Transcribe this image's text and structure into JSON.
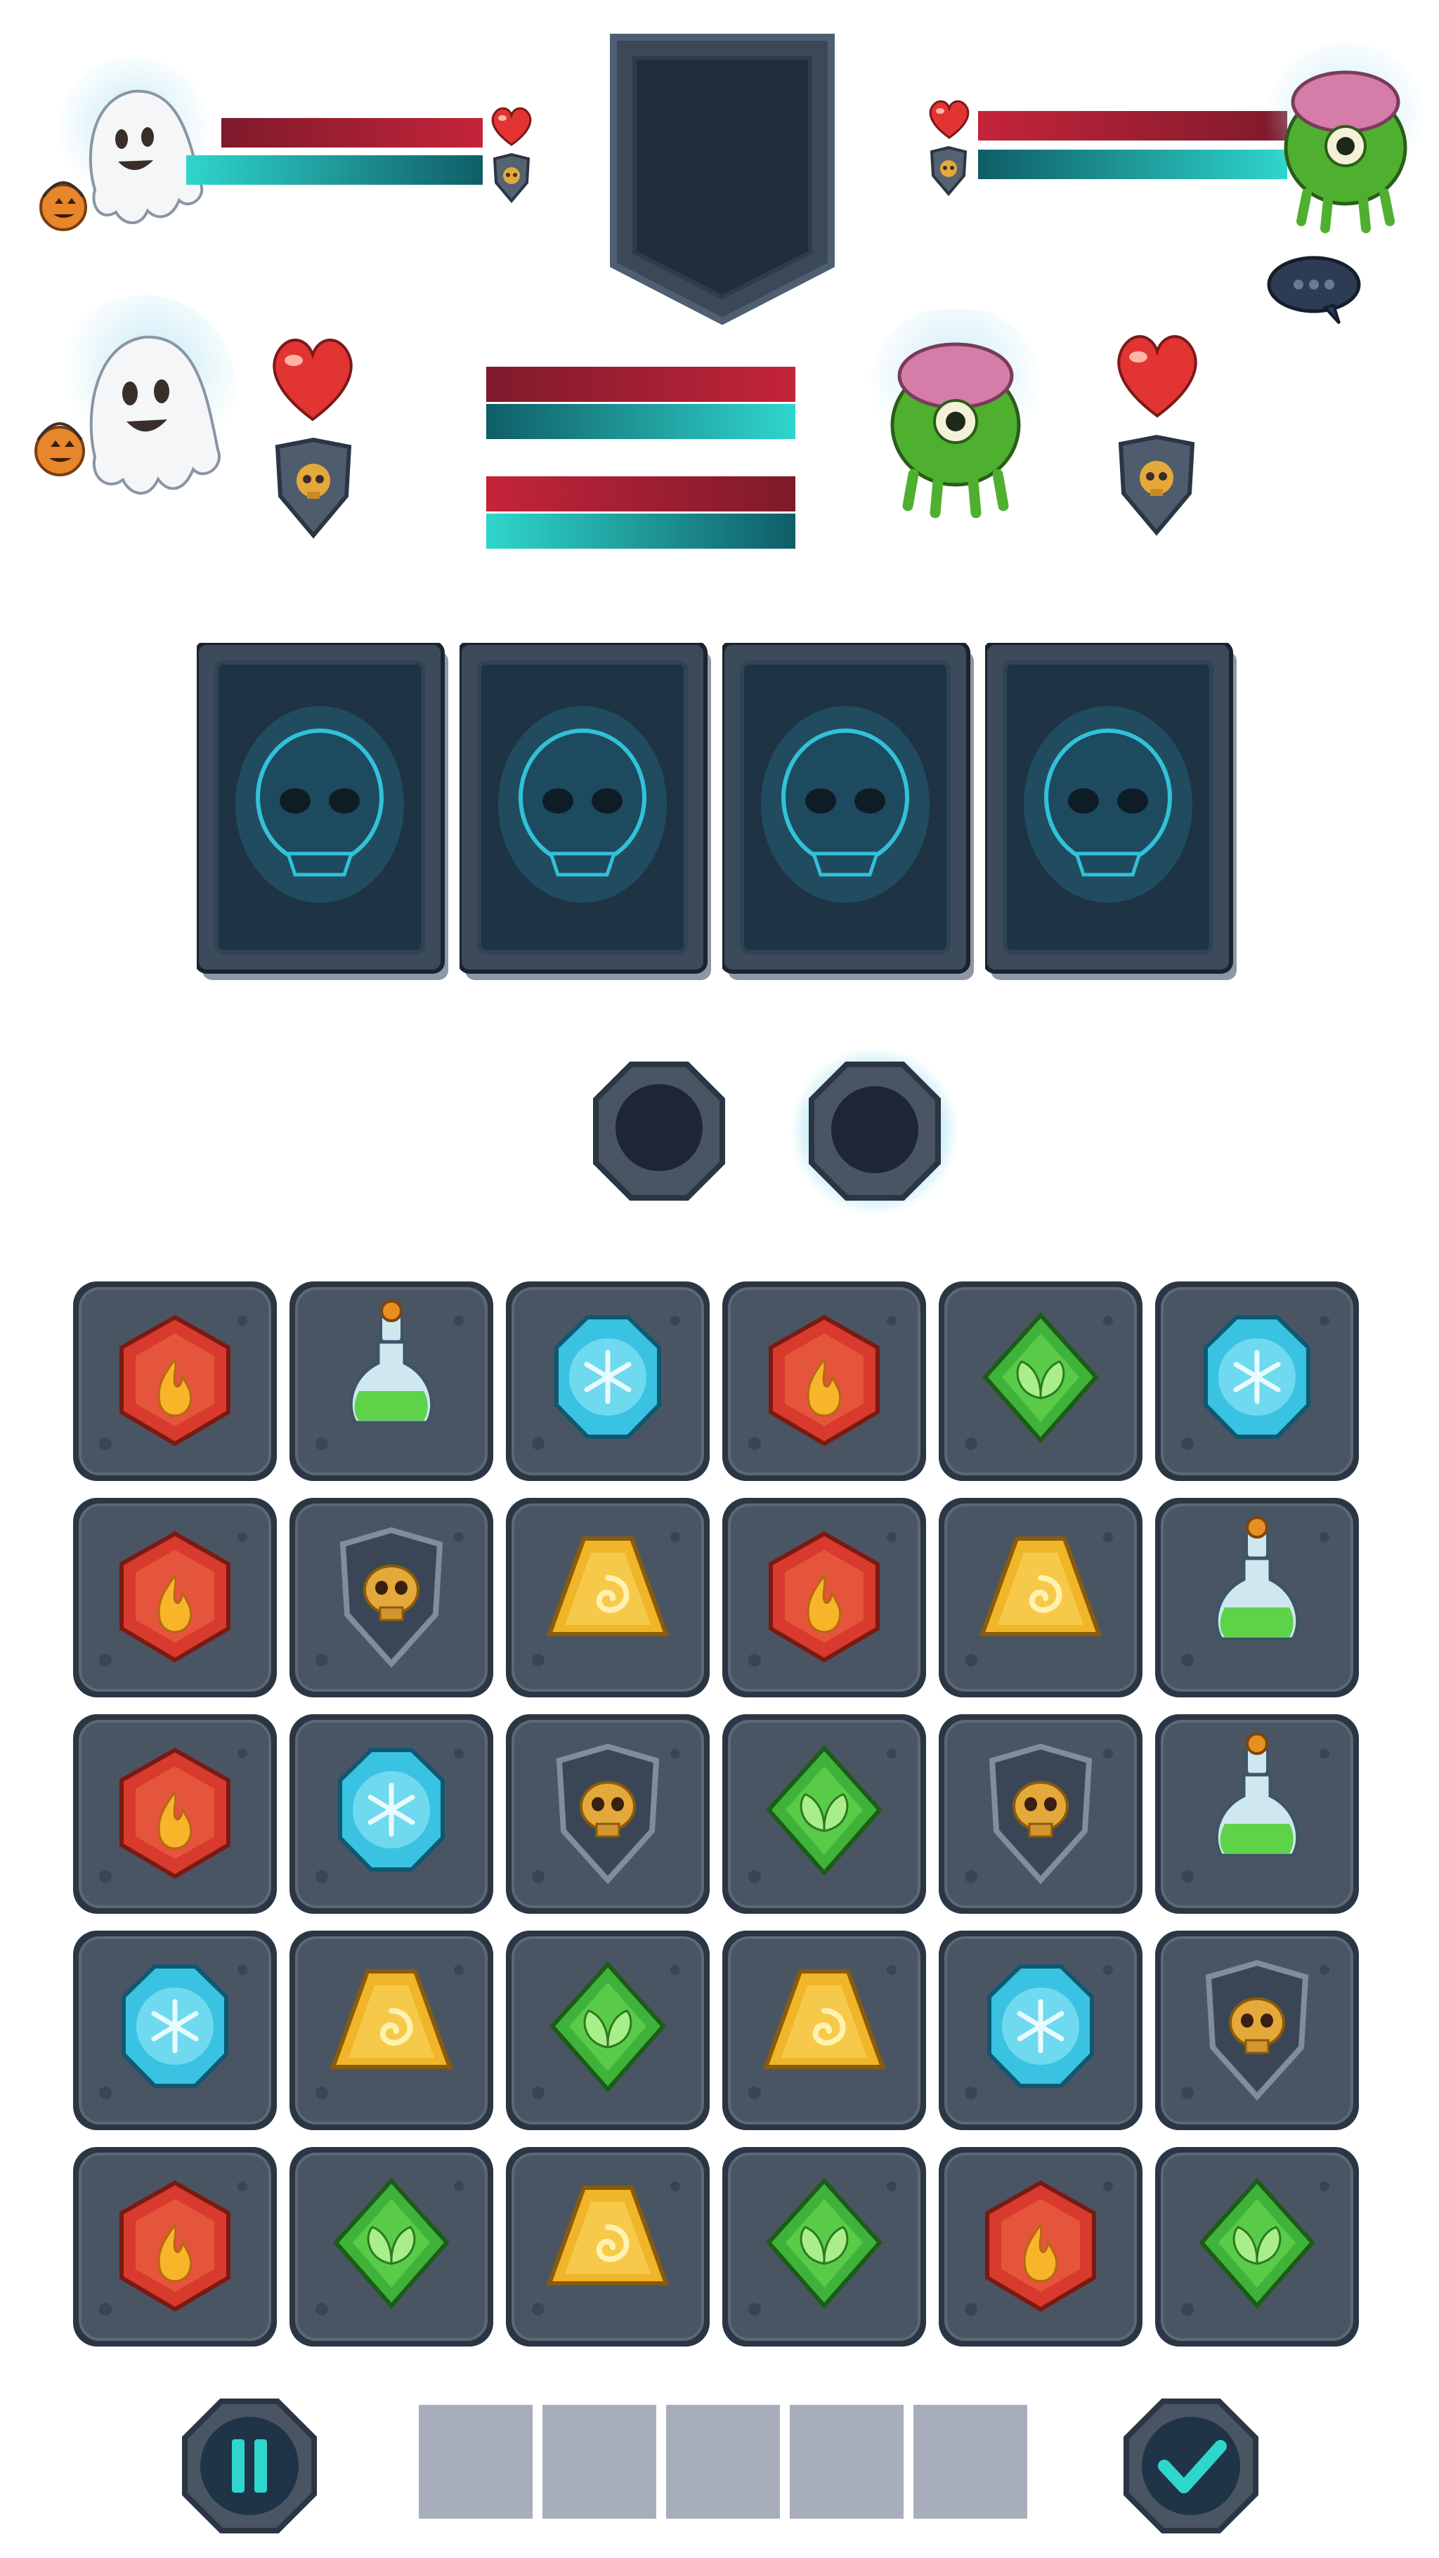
{
  "colors": {
    "health_red": "#c4243a",
    "mana_teal": "#2fd6cd",
    "stone_dark": "#2b3644",
    "stone_mid": "#4a5564",
    "slot_gray": "#a8adbb"
  },
  "player": {
    "avatar": "ghost-with-pumpkin",
    "health_fraction": 1.0,
    "mana_fraction": 1.0
  },
  "enemy": {
    "avatar": "green-brain-monster",
    "health_fraction": 1.0,
    "mana_fraction": 1.0
  },
  "board": {
    "rows": 5,
    "cols": 6,
    "tiles": [
      [
        "fire",
        "potion",
        "ice",
        "fire",
        "leaf",
        "ice"
      ],
      [
        "fire",
        "skull-shield",
        "vortex",
        "fire",
        "vortex",
        "potion"
      ],
      [
        "fire",
        "ice",
        "skull-shield",
        "leaf",
        "skull-shield",
        "potion"
      ],
      [
        "ice",
        "vortex",
        "leaf",
        "vortex",
        "ice",
        "skull-shield"
      ],
      [
        "fire",
        "leaf",
        "vortex",
        "leaf",
        "fire",
        "leaf"
      ]
    ]
  },
  "cards": {
    "count": 4,
    "back": "skull-card-back"
  },
  "slots": {
    "count": 5
  },
  "controls": {
    "pause_icon": "pause-icon",
    "confirm_icon": "check-icon"
  }
}
